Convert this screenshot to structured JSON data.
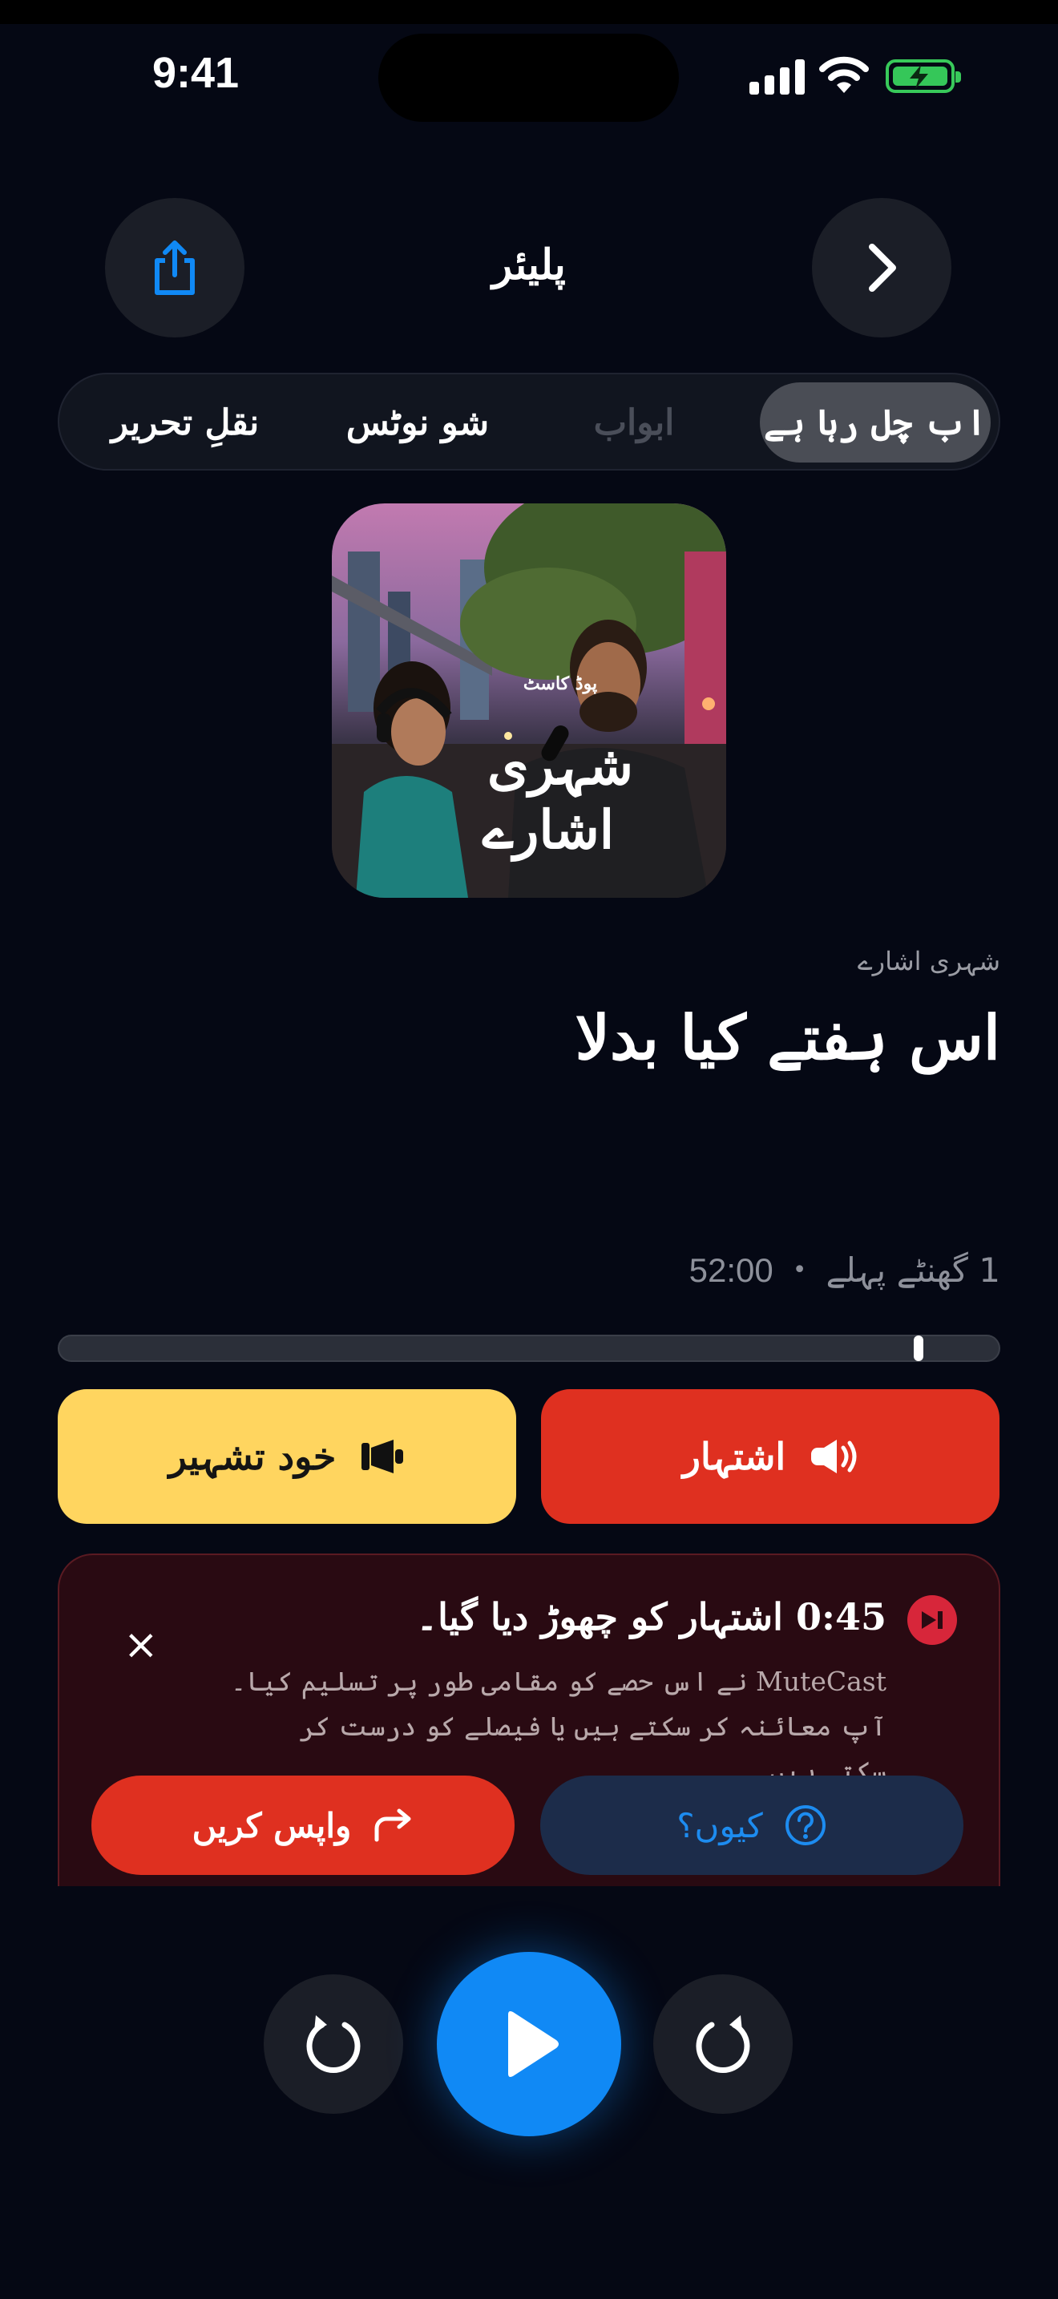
{
  "status_bar": {
    "time": "9:41"
  },
  "header": {
    "title": "پلیئر"
  },
  "tabs": [
    {
      "label": "اب چل رہا ہے",
      "active": true
    },
    {
      "label": "ابواب",
      "disabled": true
    },
    {
      "label": "شو نوٹس"
    },
    {
      "label": "نقلِ تحریر"
    }
  ],
  "cover": {
    "kicker": "پوڈ کاسٹ",
    "title_line1": "شہری",
    "title_line2": "اشارے"
  },
  "episode": {
    "show": "شہری اشارے",
    "title": "اس ہفتے کیا بدلا",
    "age": "1 گھنٹے پہلے",
    "separator": "•",
    "duration": "52:00",
    "progress": 0.916
  },
  "segments": {
    "promo_label": "خود تشہیر",
    "ad_label": "اشتہار"
  },
  "skip_panel": {
    "title": "0:45 اشتہار کو چھوڑ دیا گیا۔",
    "body": "MuteCast نے اس حصے کو مقامی طور پر تسلیم کیا۔ آپ معائنہ کر سکتے ہیں یا فیصلے کو درست کر سکتے ہیں۔",
    "close": "×",
    "why_label": "کیوں؟",
    "revert_label": "واپس کریں"
  },
  "colors": {
    "accent": "#1089f5",
    "ad": "#df3020",
    "promo": "#ffd55f",
    "background": "#050814"
  }
}
